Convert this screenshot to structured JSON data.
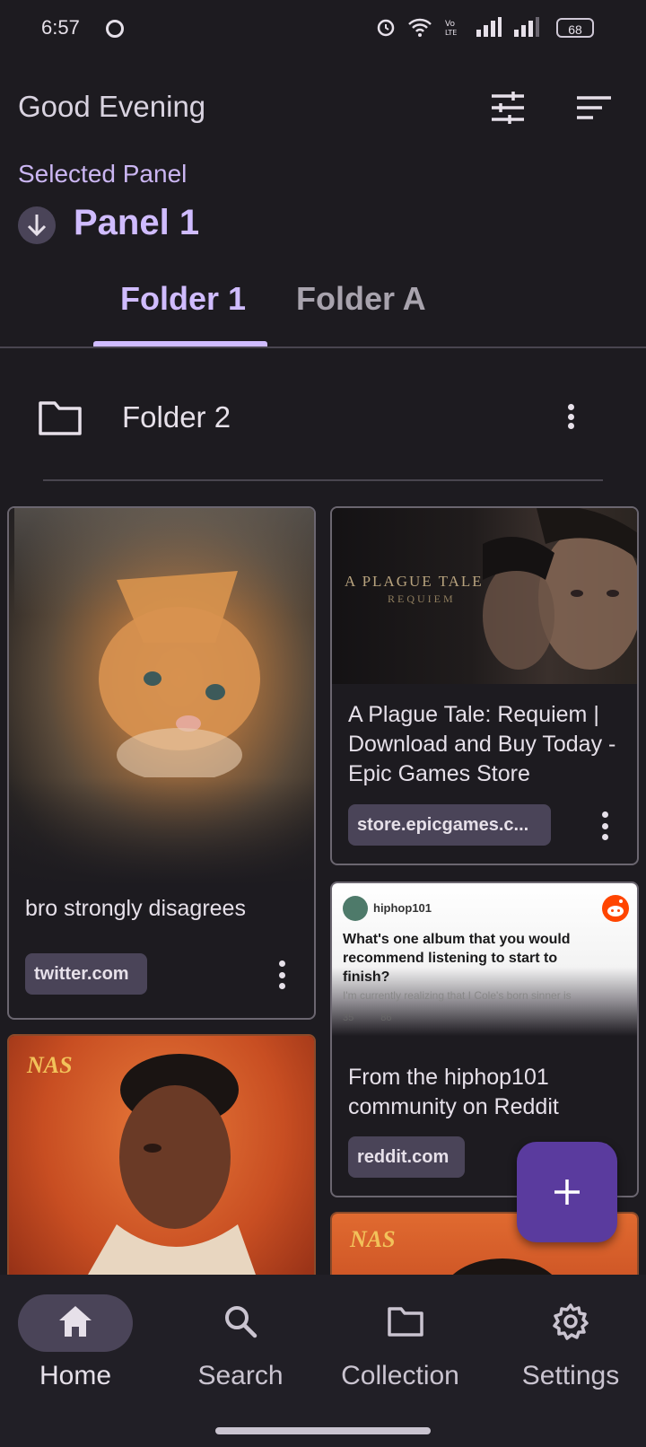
{
  "status_bar": {
    "time": "6:57",
    "battery": "68"
  },
  "header": {
    "greeting": "Good Evening",
    "selected_label": "Selected Panel",
    "panel_name": "Panel 1"
  },
  "tabs": [
    {
      "label": "Folder 1",
      "selected": true
    },
    {
      "label": "Folder A",
      "selected": false
    }
  ],
  "folder": {
    "name": "Folder 2"
  },
  "cards": {
    "cat": {
      "title": "bro strongly disagrees",
      "domain": "twitter.com"
    },
    "plague": {
      "title": "A Plague Tale: Requiem | Download and Buy Today - Epic Games Store",
      "domain": "store.epicgames.c...",
      "logo_line1": "A PLAGUE TALE",
      "logo_line2": "REQUIEM"
    },
    "reddit": {
      "title": "From the hiphop101 community on Reddit",
      "domain": "reddit.com",
      "preview_community": "hiphop101",
      "preview_question": "What's one album that you would recommend listening to start to finish?",
      "preview_body": "I'm currently realizing that I Cole's born sinner is",
      "preview_votes": "35",
      "preview_comments": "86"
    },
    "nas": {
      "logo": "NAS"
    }
  },
  "nav": [
    {
      "label": "Home",
      "icon": "home-icon",
      "selected": true
    },
    {
      "label": "Search",
      "icon": "search-icon",
      "selected": false
    },
    {
      "label": "Collection",
      "icon": "folder-icon",
      "selected": false
    },
    {
      "label": "Settings",
      "icon": "gear-icon",
      "selected": false
    }
  ],
  "colors": {
    "accent": "#d0bcff",
    "background": "#1d1b20",
    "fab": "#5a3b9e"
  }
}
